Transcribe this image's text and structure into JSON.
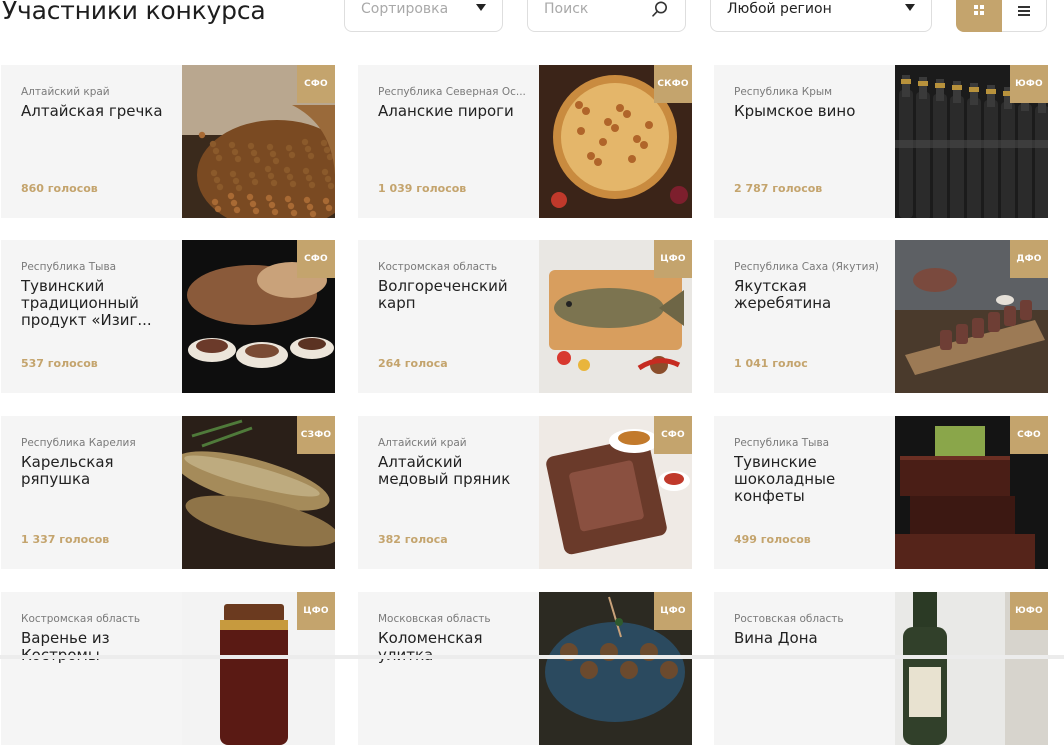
{
  "header": {
    "title": "Участники конкурса",
    "sort_placeholder": "Сортировка",
    "search_placeholder": "Поиск",
    "region_value": "Любой регион"
  },
  "icons": {
    "sort": "chevron-down-icon",
    "search": "search-icon",
    "region": "chevron-down-icon",
    "grid_view": "grid-view-icon",
    "list_view": "list-view-icon"
  },
  "colors": {
    "accent": "#c4a46d",
    "card_bg": "#f5f5f5"
  },
  "cards": [
    {
      "region": "Алтайский край",
      "title": "Алтайская гречка",
      "votes": "860 голосов",
      "district": "СФО"
    },
    {
      "region": "Республика Северная Ос...",
      "title": "Аланские пироги",
      "votes": "1 039 голосов",
      "district": "СКФО"
    },
    {
      "region": "Республика Крым",
      "title": "Крымское вино",
      "votes": "2 787 голосов",
      "district": "ЮФО"
    },
    {
      "region": "Республика Тыва",
      "title": "Тувинский традиционный продукт «Изиг...",
      "votes": "537 голосов",
      "district": "СФО"
    },
    {
      "region": "Костромская область",
      "title": "Волгореченский карп",
      "votes": "264 голоса",
      "district": "ЦФО"
    },
    {
      "region": "Республика Саха (Якутия)",
      "title": "Якутская жеребятина",
      "votes": "1 041 голос",
      "district": "ДФО"
    },
    {
      "region": "Республика Карелия",
      "title": "Карельская ряпушка",
      "votes": "1 337 голосов",
      "district": "СЗФО"
    },
    {
      "region": "Алтайский край",
      "title": "Алтайский медовый пряник",
      "votes": "382 голоса",
      "district": "СФО"
    },
    {
      "region": "Республика Тыва",
      "title": "Тувинские шоколадные конфеты",
      "votes": "499 голосов",
      "district": "СФО"
    },
    {
      "region": "Костромская область",
      "title": "Варенье из Костромы",
      "votes": "",
      "district": "ЦФО"
    },
    {
      "region": "Московская область",
      "title": "Коломенская улитка",
      "votes": "",
      "district": "ЦФО"
    },
    {
      "region": "Ростовская область",
      "title": "Вина Дона",
      "votes": "",
      "district": "ЮФО"
    }
  ]
}
